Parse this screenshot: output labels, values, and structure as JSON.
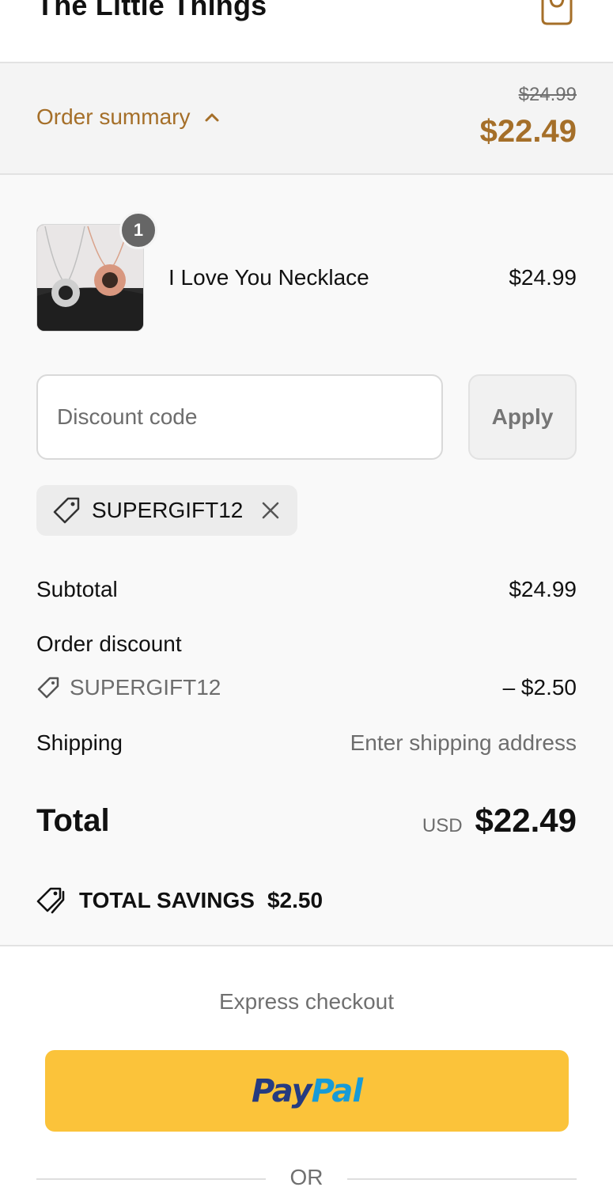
{
  "header": {
    "store_title": "The Little Things",
    "cart_icon": "shopping-bag-icon"
  },
  "summary_bar": {
    "toggle_label": "Order summary",
    "toggle_icon": "chevron-up-icon",
    "original_price": "$24.99",
    "final_price": "$22.49"
  },
  "line_items": [
    {
      "name": "I Love You Necklace",
      "price": "$24.99",
      "quantity": "1"
    }
  ],
  "discount": {
    "placeholder": "Discount code",
    "apply_label": "Apply",
    "applied_code": "SUPERGIFT12"
  },
  "totals": {
    "subtotal_label": "Subtotal",
    "subtotal_value": "$24.99",
    "order_discount_label": "Order discount",
    "discount_code": "SUPERGIFT12",
    "discount_value": "– $2.50",
    "shipping_label": "Shipping",
    "shipping_value": "Enter shipping address",
    "total_label": "Total",
    "currency": "USD",
    "total_value": "$22.49",
    "savings_label": "TOTAL SAVINGS",
    "savings_value": "$2.50"
  },
  "checkout": {
    "express_label": "Express checkout",
    "paypal_part1": "Pay",
    "paypal_part2": "Pal",
    "or_label": "OR"
  },
  "colors": {
    "accent": "#a56f29",
    "paypal_yellow": "#fbc33a",
    "paypal_dark_blue": "#253b80",
    "paypal_light_blue": "#179bd7"
  }
}
